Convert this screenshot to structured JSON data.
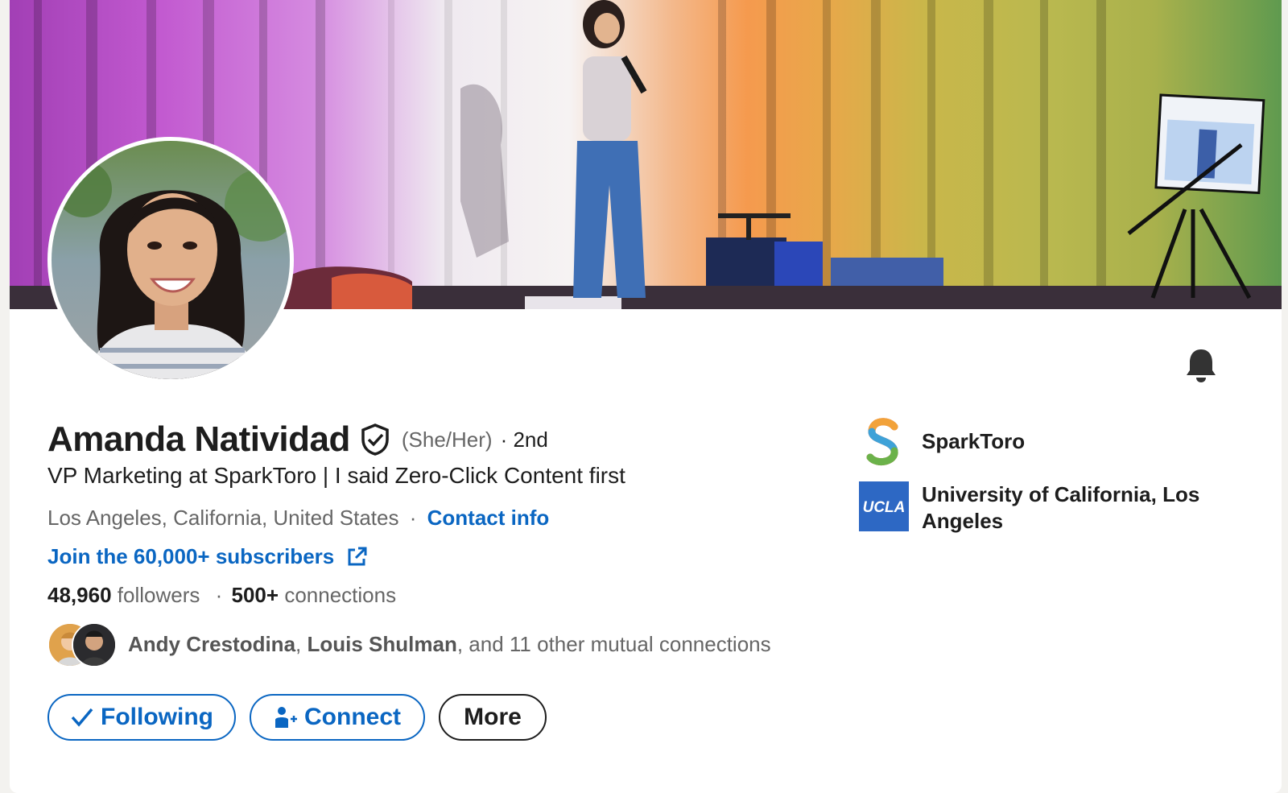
{
  "profile": {
    "name": "Amanda Natividad",
    "pronouns": "(She/Her)",
    "degree": "· 2nd",
    "headline": "VP Marketing at SparkToro | I said Zero-Click Content first",
    "location": "Los Angeles, California, United States",
    "location_sep": "·",
    "contact_info": "Contact info",
    "website_label": "Join the 60,000+ subscribers",
    "followers_count": "48,960",
    "followers_label": "followers",
    "stats_sep": "·",
    "connections_count": "500+",
    "connections_label": "connections",
    "mutual": {
      "name1": "Andy Crestodina",
      "sep": ",",
      "name2": "Louis Shulman",
      "rest": ", and 11 other mutual connections"
    }
  },
  "actions": {
    "following": "Following",
    "connect": "Connect",
    "more": "More"
  },
  "organizations": [
    {
      "name": "SparkToro",
      "icon": "sparktoro-logo"
    },
    {
      "name": "University of California, Los Angeles",
      "icon": "ucla-logo",
      "logo_text": "UCLA"
    }
  ],
  "colors": {
    "link": "#0a66c2",
    "text": "#1d1d1d",
    "muted": "#666666",
    "ucla_blue": "#2d68c4"
  }
}
